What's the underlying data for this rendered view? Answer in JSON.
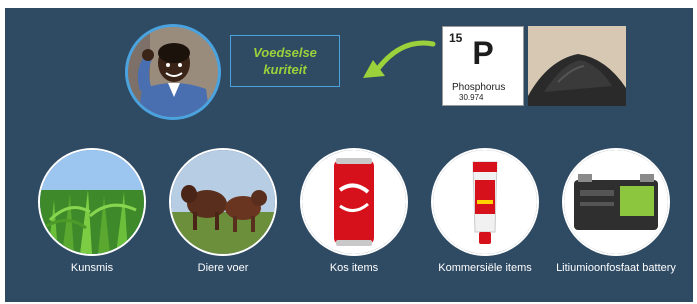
{
  "top": {
    "food_security_label": "Voedselse kuriteit",
    "element": {
      "number": "15",
      "symbol": "P",
      "name": "Phosphorus",
      "mass": "30.974"
    }
  },
  "items": [
    {
      "label": "Kunsmis",
      "icon": "corn-field"
    },
    {
      "label": "Diere voer",
      "icon": "cattle"
    },
    {
      "label": "Kos items",
      "icon": "soda-can"
    },
    {
      "label": "Kommersiële items",
      "icon": "toothpaste"
    },
    {
      "label": "Litiumioonfosfaat battery",
      "icon": "battery"
    }
  ],
  "colors": {
    "background": "#2f4a63",
    "accent_blue": "#4aa3df",
    "accent_green": "#9bd13a"
  }
}
